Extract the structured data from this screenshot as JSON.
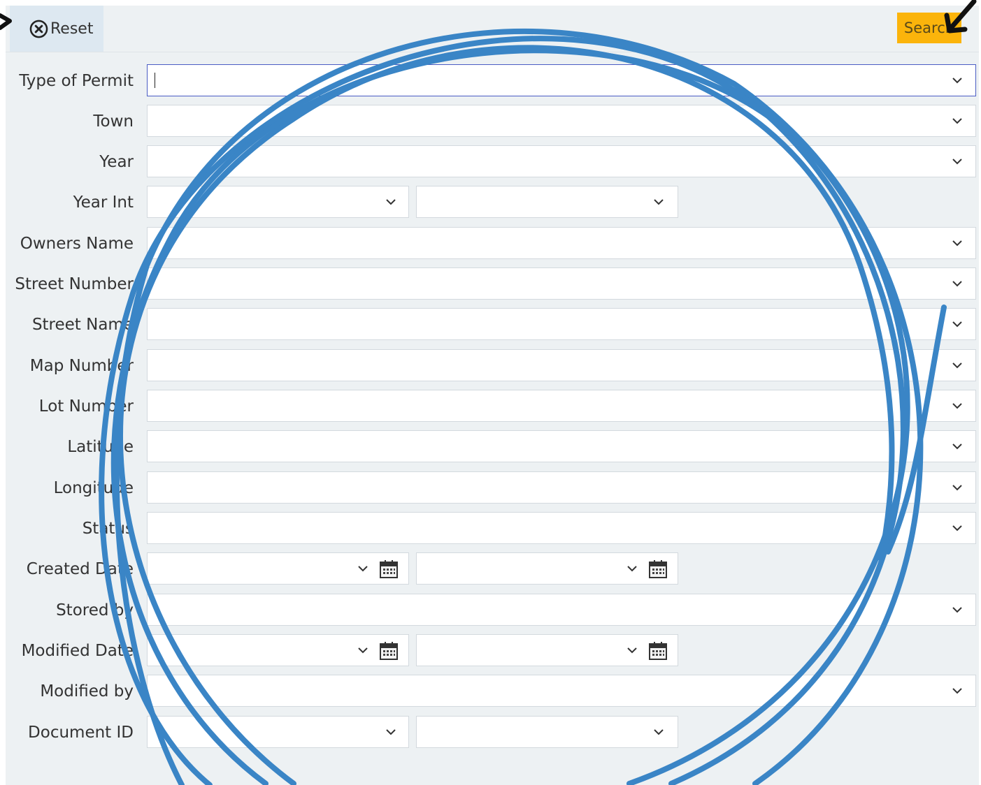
{
  "toolbar": {
    "reset_label": "Reset",
    "search_label": "Search"
  },
  "form": {
    "type_of_permit": {
      "label": "Type of Permit",
      "value": ""
    },
    "town": {
      "label": "Town",
      "value": ""
    },
    "year": {
      "label": "Year",
      "value": ""
    },
    "year_int": {
      "label": "Year Int",
      "from": "",
      "to": ""
    },
    "owners_name": {
      "label": "Owners Name",
      "value": ""
    },
    "street_number": {
      "label": "Street Number",
      "value": ""
    },
    "street_name": {
      "label": "Street Name",
      "value": ""
    },
    "map_number": {
      "label": "Map Number",
      "value": ""
    },
    "lot_number": {
      "label": "Lot Number",
      "value": ""
    },
    "latitude": {
      "label": "Latitude",
      "value": ""
    },
    "longitude": {
      "label": "Longitude",
      "value": ""
    },
    "status": {
      "label": "Status",
      "value": ""
    },
    "created_date": {
      "label": "Created Date",
      "from": "",
      "to": ""
    },
    "stored_by": {
      "label": "Stored by",
      "value": ""
    },
    "modified_date": {
      "label": "Modified Date",
      "from": "",
      "to": ""
    },
    "modified_by": {
      "label": "Modified by",
      "value": ""
    },
    "document_id": {
      "label": "Document ID",
      "from": "",
      "to": ""
    }
  },
  "icons": {
    "reset": "x-circle-icon",
    "dropdown": "chevron-down-icon",
    "calendar": "calendar-icon"
  },
  "colors": {
    "search_button": "#fbb40b",
    "reset_button_bg": "#dde8f1",
    "panel_bg": "#edf1f3",
    "focus_border": "#4a5cc4",
    "annotation": "#3a85c6"
  }
}
